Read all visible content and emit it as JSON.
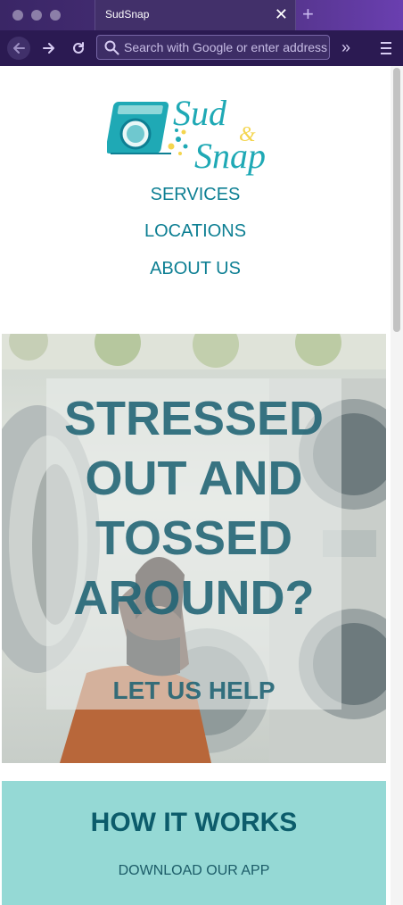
{
  "browser": {
    "tab_title": "SudSnap",
    "tab_close": "✕",
    "new_tab": "+",
    "search_placeholder": "Search with Google or enter address",
    "overflow": "»"
  },
  "site": {
    "logo": {
      "line1": "Sud",
      "amp": "&",
      "line2": "Snap"
    },
    "nav": [
      "SERVICES",
      "LOCATIONS",
      "ABOUT US"
    ],
    "hero": {
      "title_lines": [
        "STRESSED",
        "OUT AND",
        "TOSSED",
        "AROUND?"
      ],
      "subtitle": "LET US HELP"
    },
    "how_it_works": {
      "title": "HOW IT WORKS",
      "step": "DOWNLOAD OUR APP"
    }
  },
  "colors": {
    "chrome": "#2b1a52",
    "nav_link": "#0d7f93",
    "hero_text": "#1f6374",
    "how_bg": "#95d9d5"
  }
}
